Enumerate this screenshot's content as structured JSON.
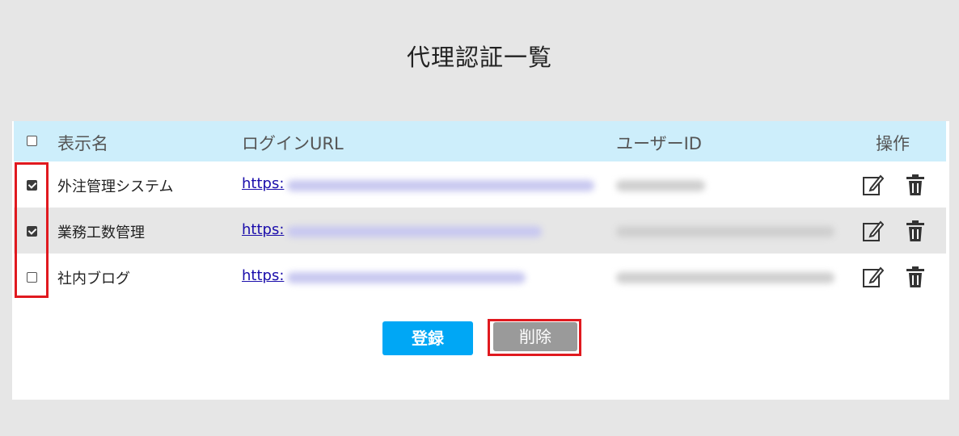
{
  "page": {
    "title": "代理認証一覧"
  },
  "table": {
    "headers": {
      "name": "表示名",
      "url": "ログインURL",
      "userid": "ユーザーID",
      "actions": "操作"
    },
    "rows": [
      {
        "checked": true,
        "name": "外注管理システム",
        "url_visible": "https:"
      },
      {
        "checked": true,
        "name": "業務工数管理",
        "url_visible": "https:"
      },
      {
        "checked": false,
        "name": "社内ブログ",
        "url_visible": "https:"
      }
    ]
  },
  "buttons": {
    "register": "登録",
    "delete": "削除"
  },
  "colors": {
    "header_bg": "#cdeefb",
    "register_bg": "#00a7f5",
    "delete_bg": "#9a9a9a",
    "highlight": "#e0191f"
  },
  "icons": {
    "edit": "edit-icon",
    "delete": "trash-icon"
  }
}
